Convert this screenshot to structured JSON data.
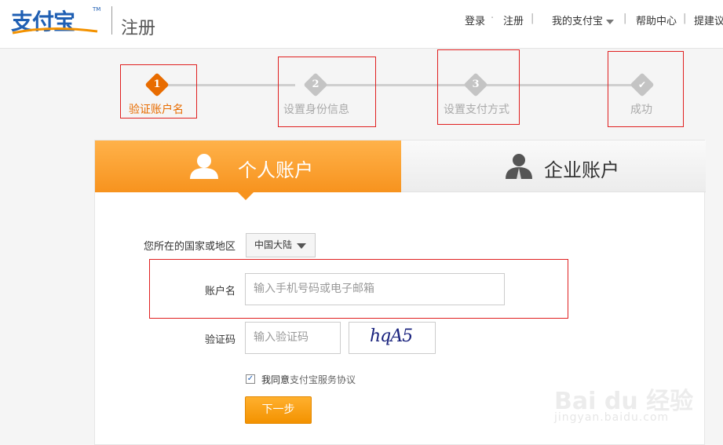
{
  "header": {
    "logo_text": "支付宝",
    "logo_tm": "TM",
    "page_title": "注册",
    "nav": {
      "login": "登录",
      "dot": "·",
      "register": "注册",
      "divider": "|",
      "my_alipay": "我的支付宝",
      "help": "帮助中心",
      "feedback": "提建议"
    }
  },
  "steps": [
    {
      "num": "1",
      "label": "验证账户名",
      "state": "active"
    },
    {
      "num": "2",
      "label": "设置身份信息",
      "state": "pending"
    },
    {
      "num": "3",
      "label": "设置支付方式",
      "state": "pending"
    },
    {
      "num": "✔",
      "label": "成功",
      "state": "pending"
    }
  ],
  "tabs": {
    "personal": "个人账户",
    "business": "企业账户"
  },
  "form": {
    "region_label": "您所在的国家或地区",
    "region_value": "中国大陆",
    "account_label": "账户名",
    "account_placeholder": "输入手机号码或电子邮箱",
    "captcha_label": "验证码",
    "captcha_placeholder": "输入验证码",
    "captcha_text": "hqA5",
    "agree_prefix": "我同意",
    "agree_link": "支付宝服务协议",
    "agree_checked": true,
    "next_button": "下一步"
  },
  "watermark": {
    "main": "Bai du 经验",
    "sub": "jingyan.baidu.com"
  },
  "colors": {
    "accent_orange": "#f7931e",
    "active_step": "#e86c00",
    "pending_step": "#c8c8c8",
    "brand_blue": "#1f5fb3",
    "annotation_red": "#e02020"
  }
}
